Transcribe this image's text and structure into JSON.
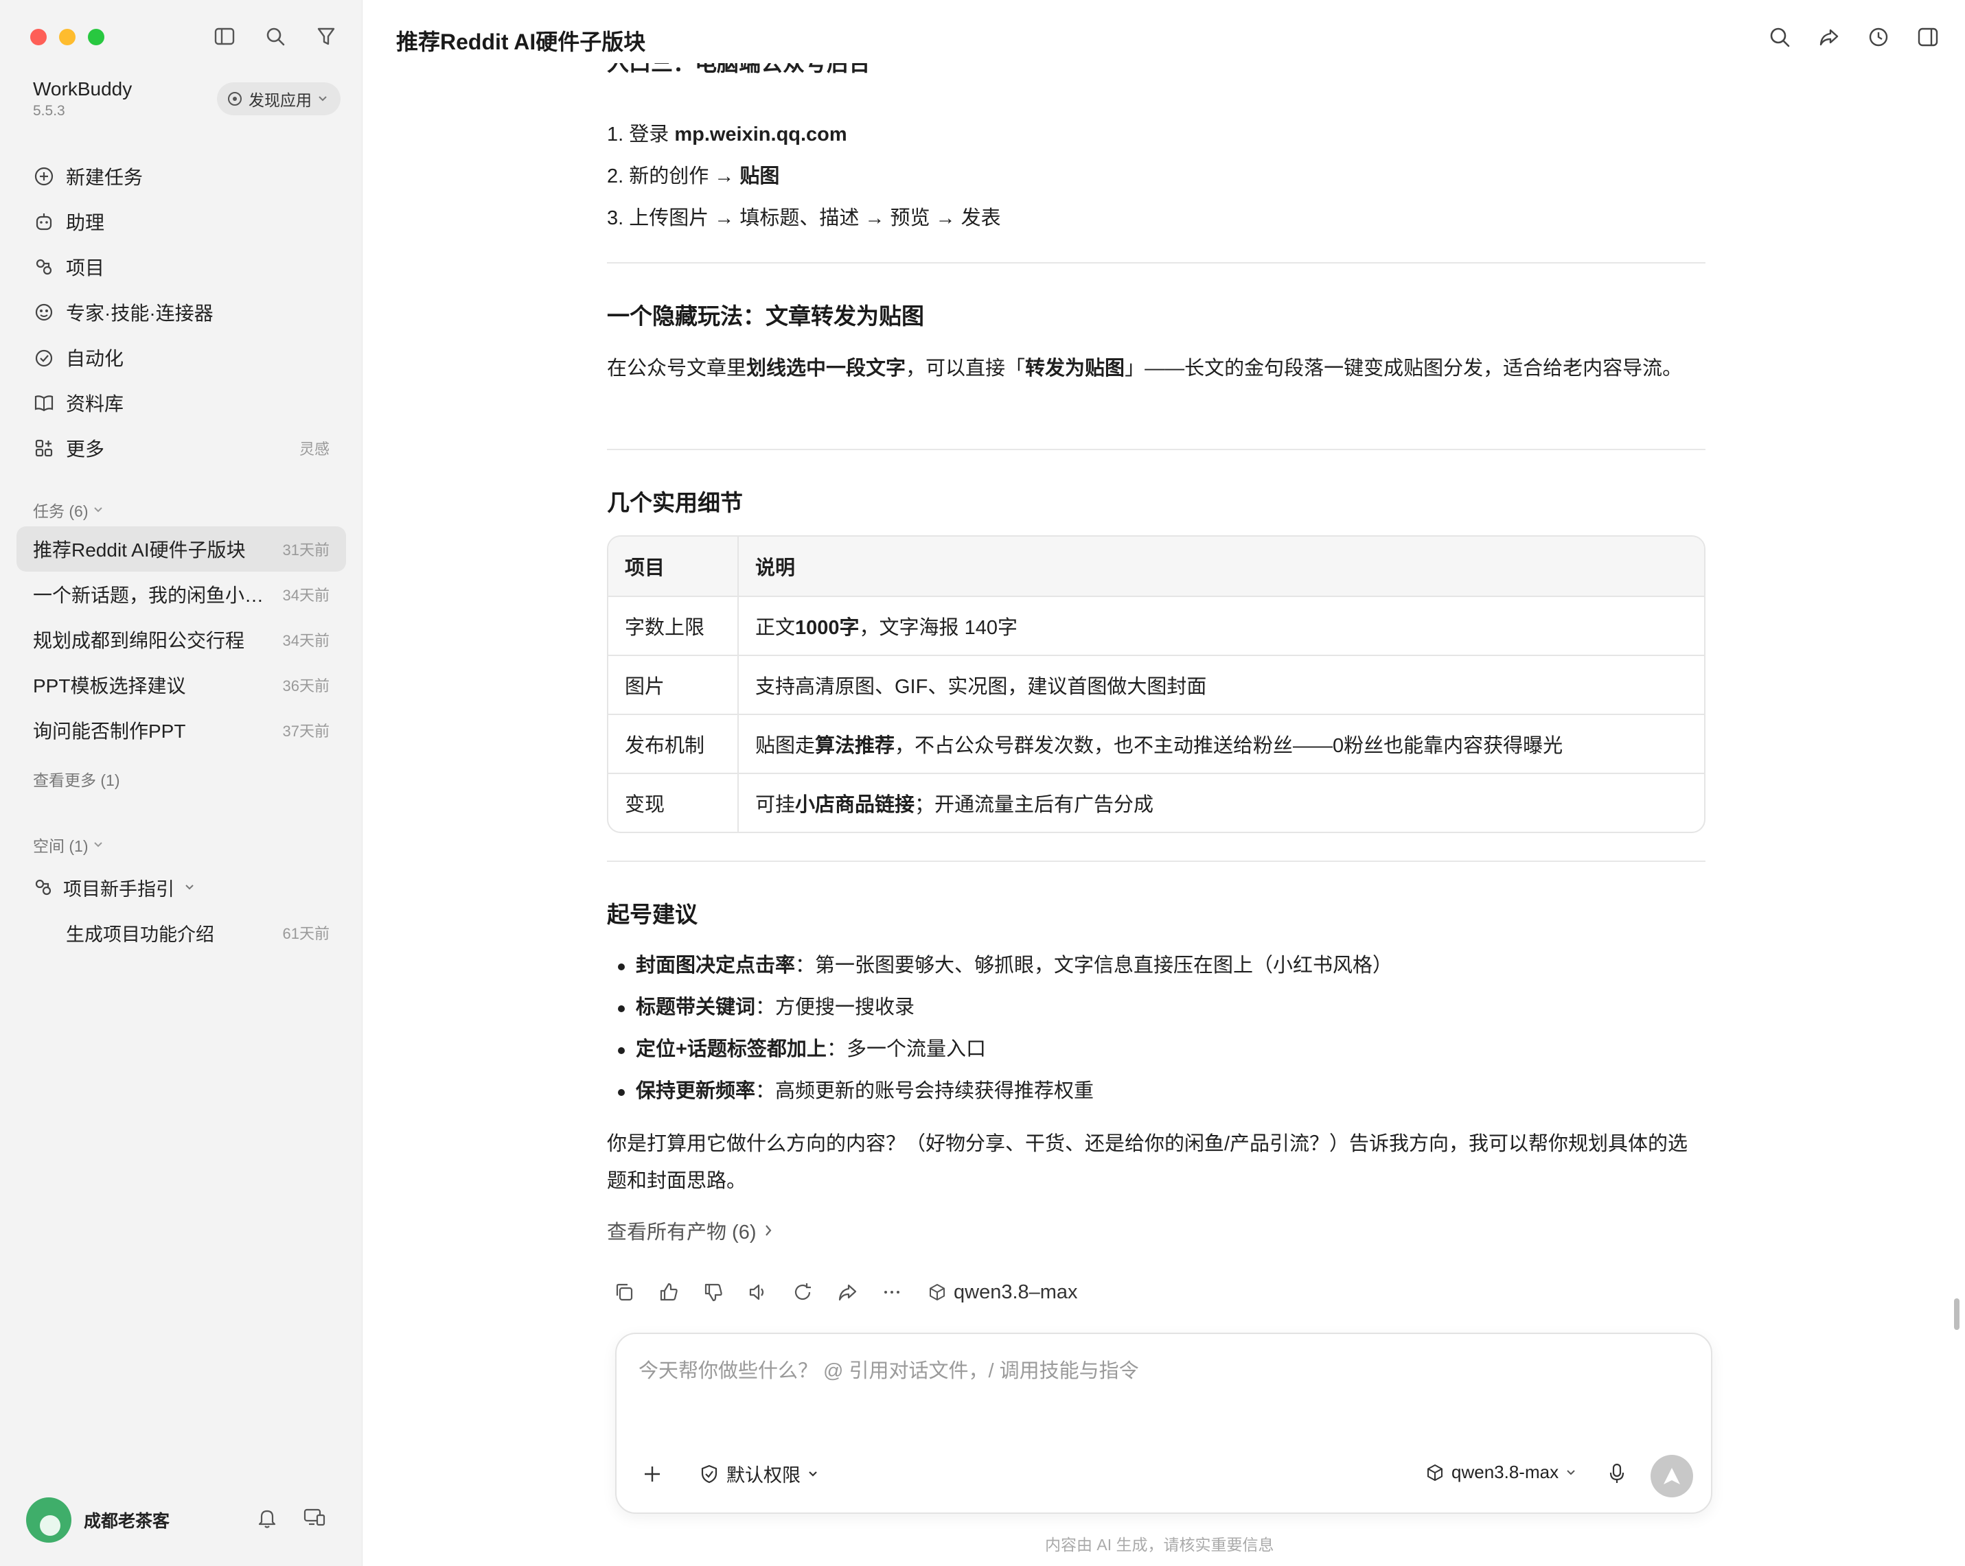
{
  "app": {
    "name": "WorkBuddy",
    "version": "5.5.3",
    "discover_label": "发现应用"
  },
  "nav": [
    {
      "label": "新建任务",
      "icon": "plus-circle-icon"
    },
    {
      "label": "助理",
      "icon": "assistant-icon"
    },
    {
      "label": "项目",
      "icon": "project-icon"
    },
    {
      "label": "专家·技能·连接器",
      "icon": "expert-icon"
    },
    {
      "label": "自动化",
      "icon": "automation-icon"
    },
    {
      "label": "资料库",
      "icon": "library-icon"
    },
    {
      "label": "更多",
      "icon": "more-grid-icon",
      "aux": "灵感"
    }
  ],
  "tasks_section": {
    "header": "任务 (6)",
    "items": [
      {
        "title": "推荐Reddit AI硬件子版块",
        "time": "31天前",
        "active": true
      },
      {
        "title": "一个新话题，我的闲鱼小店铺…",
        "time": "34天前"
      },
      {
        "title": "规划成都到绵阳公交行程",
        "time": "34天前"
      },
      {
        "title": "PPT模板选择建议",
        "time": "36天前"
      },
      {
        "title": "询问能否制作PPT",
        "time": "37天前"
      }
    ],
    "more_label": "查看更多 (1)"
  },
  "spaces_section": {
    "header": "空间 (1)",
    "project": "项目新手指引",
    "sub_item": {
      "title": "生成项目功能介绍",
      "time": "61天前"
    }
  },
  "user": {
    "name": "成都老茶客"
  },
  "header": {
    "title": "推荐Reddit AI硬件子版块"
  },
  "article": {
    "clipped_heading": "入口三：电脑端公众号后台",
    "steps": {
      "s1_prefix": "1. 登录 ",
      "s1_value": "mp.weixin.qq.com",
      "s2_prefix": "2. 新的创作 → ",
      "s2_value": "贴图",
      "s3": "3. 上传图片 → 填标题、描述 → 预览 → 发表"
    },
    "hidden_trick": {
      "heading": "一个隐藏玩法：文章转发为贴图",
      "p_a": "在公众号文章里",
      "p_b": "划线选中一段文字",
      "p_c": "，可以直接「",
      "p_d": "转发为贴图",
      "p_e": "」——长文的金句段落一键变成贴图分发，适合给老内容导流。"
    },
    "details": {
      "heading": "几个实用细节",
      "col1": "项目",
      "col2": "说明",
      "r1_k": "字数上限",
      "r1_a": "正文 ",
      "r1_b": "1000字",
      "r1_c": "，文字海报 140字",
      "r2_k": "图片",
      "r2_v": "支持高清原图、GIF、实况图，建议首图做大图封面",
      "r3_k": "发布机制",
      "r3_a": "贴图走",
      "r3_b": "算法推荐",
      "r3_c": "，不占公众号群发次数，也不主动推送给粉丝——0粉丝也能靠内容获得曝光",
      "r4_k": "变现",
      "r4_a": "可挂",
      "r4_b": "小店商品链接",
      "r4_c": "；开通流量主后有广告分成"
    },
    "start_tips": {
      "heading": "起号建议",
      "t1_b": "封面图决定点击率",
      "t1_r": "：第一张图要够大、够抓眼，文字信息直接压在图上（小红书风格）",
      "t2_b": "标题带关键词",
      "t2_r": "：方便搜一搜收录",
      "t3_b": "定位+话题标签都加上",
      "t3_r": "：多一个流量入口",
      "t4_b": "保持更新频率",
      "t4_r": "：高频更新的账号会持续获得推荐权重"
    },
    "closing": "你是打算用它做什么方向的内容？（好物分享、干货、还是给你的闲鱼/产品引流？）告诉我方向，我可以帮你规划具体的选题和封面思路。",
    "artifacts_label": "查看所有产物 (6)"
  },
  "message_actions": {
    "model": "qwen3.8–max"
  },
  "composer": {
    "placeholder": "今天帮你做些什么？ @ 引用对话文件，/ 调用技能与指令",
    "permission": "默认权限",
    "model": "qwen3.8-max"
  },
  "footer_note": "内容由 AI 生成，请核实重要信息"
}
